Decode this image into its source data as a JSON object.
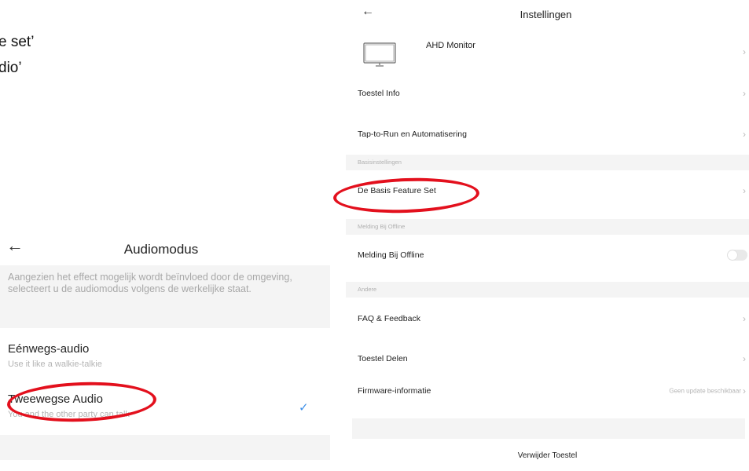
{
  "captions": {
    "line1": "e set’",
    "line2": "dio’"
  },
  "audiomodus": {
    "back_icon": "arrow-left-icon",
    "title": "Audiomodus",
    "info_text": "Aangezien het effect mogelijk wordt beïnvloed door de omgeving, selecteert u de audiomodus volgens de werkelijke staat.",
    "options": [
      {
        "title": "Eénwegs-audio",
        "subtitle": "Use it like a walkie-talkie",
        "selected": false
      },
      {
        "title": "Tweewegse Audio",
        "subtitle": "You and the other party can talk",
        "selected": true
      }
    ],
    "check_glyph": "✓"
  },
  "settings": {
    "back_icon": "arrow-left-icon",
    "title": "Instellingen",
    "device_name": "AHD Monitor",
    "rows": {
      "device_info": "Toestel Info",
      "tap_to_run": "Tap-to-Run en Automatisering",
      "basic_feature_set": "De Basis Feature Set",
      "offline_notification": "Melding Bij Offline",
      "faq": "FAQ & Feedback",
      "share": "Toestel Delen",
      "firmware": "Firmware-informatie"
    },
    "sections": {
      "basic": "Basisinstellingen",
      "offline": "Melding Bij Offline",
      "other": "Andere"
    },
    "offline_toggle_on": false,
    "firmware_status": "Geen update beschikbaar",
    "remove_button": "Verwijder Toestel",
    "chevron": "›"
  },
  "annotation_color": "#e3101d",
  "accent_color": "#3d8fe8"
}
